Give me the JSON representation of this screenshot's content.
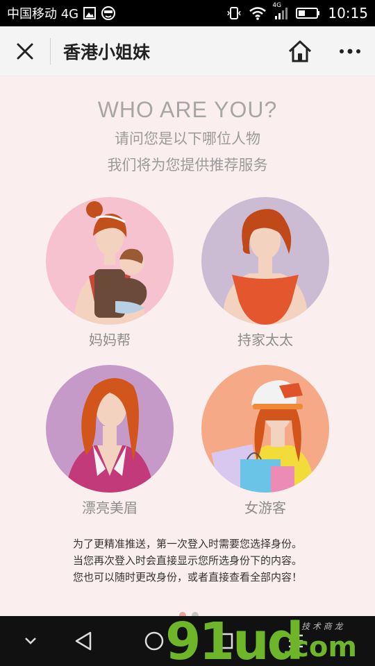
{
  "status_bar": {
    "carrier": "中国移动 4G",
    "time": "10:15",
    "network_badge": "4G"
  },
  "title_bar": {
    "title": "香港小姐妹"
  },
  "content": {
    "headline": "WHO ARE YOU?",
    "subtitle_1": "请问您是以下哪位人物",
    "subtitle_2": "我们将为您提供推荐服务",
    "personas": [
      {
        "label": "妈妈帮",
        "bg_color": "#f6c2cf"
      },
      {
        "label": "持家太太",
        "bg_color": "#cbbbd3"
      },
      {
        "label": "漂亮美眉",
        "bg_color": "#c59ac9"
      },
      {
        "label": "女游客",
        "bg_color": "#f5a986"
      }
    ],
    "notice_lines": [
      "为了更精准推送，第一次登入时需要您选择身份。",
      "当您再次登入时会直接显示您所选身份下的内容。",
      "您也可以随时更改身份，或者直接查看全部内容！"
    ]
  },
  "watermark": {
    "big": "91ud",
    "suffix": ".com",
    "small": "技 术 商 龙"
  },
  "colors": {
    "page_bg": "#fbeeee",
    "title_bar_bg": "#f4f4f4",
    "watermark_green": "#6eb52a"
  }
}
